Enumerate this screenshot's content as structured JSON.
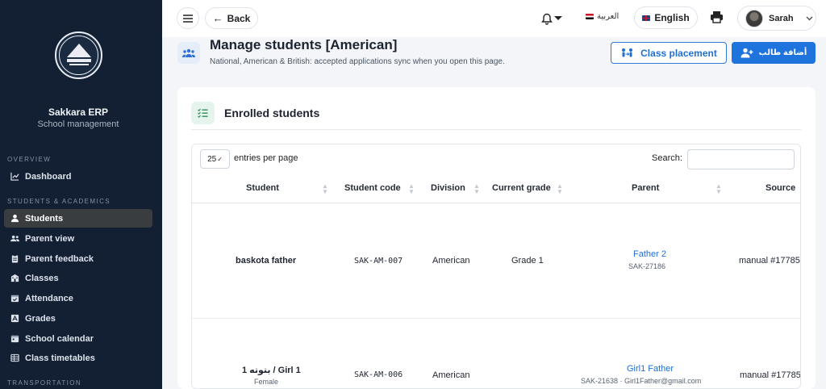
{
  "brand": {
    "title": "Sakkara ERP",
    "subtitle": "School management"
  },
  "sidebar": {
    "sections": [
      {
        "label": "Overview"
      },
      {
        "label": "Students & Academics"
      },
      {
        "label": "Transportation"
      }
    ],
    "items": [
      {
        "label": "Dashboard",
        "icon": "chart-line-icon"
      },
      {
        "label": "Students",
        "icon": "student-icon",
        "active": true
      },
      {
        "label": "Parent view",
        "icon": "users-icon"
      },
      {
        "label": "Parent feedback",
        "icon": "clipboard-icon"
      },
      {
        "label": "Classes",
        "icon": "school-icon"
      },
      {
        "label": "Attendance",
        "icon": "calendar-check-icon"
      },
      {
        "label": "Grades",
        "icon": "grades-icon"
      },
      {
        "label": "School calendar",
        "icon": "calendar-icon"
      },
      {
        "label": "Class timetables",
        "icon": "table-icon"
      }
    ]
  },
  "topbar": {
    "back_label": "Back",
    "arabic_label": "العربية",
    "english_label": "English",
    "user_name": "Sarah"
  },
  "page": {
    "title": "Manage students [American]",
    "subtitle": "National, American & British: accepted applications sync when you open this page.",
    "class_placement_label": "Class placement",
    "add_student_label": "أضافة طالب"
  },
  "card": {
    "title": "Enrolled students",
    "entries_value": "25",
    "entries_label": "entries per page",
    "search_label": "Search:"
  },
  "table": {
    "columns": [
      "Student",
      "Student code",
      "Division",
      "Current grade",
      "Parent",
      "Source"
    ],
    "rows": [
      {
        "student": "baskota father",
        "student_sub": "",
        "code": "SAK-AM-007",
        "division": "American",
        "grade": "Grade 1",
        "parent": "Father 2",
        "parent_sub": "SAK-27186",
        "source": "manual #17785"
      },
      {
        "student": "بتوته 1 / Girl 1",
        "student_sub": "Female",
        "code": "SAK-AM-006",
        "division": "American",
        "grade": "",
        "parent": "Girl1 Father",
        "parent_sub": "SAK-21638 · Girl1Father@gmail.com",
        "source": "manual #17785"
      }
    ]
  },
  "colors": {
    "sidebar_bg": "#132033",
    "accent": "#1f73dd",
    "link": "#1f6fd1"
  }
}
